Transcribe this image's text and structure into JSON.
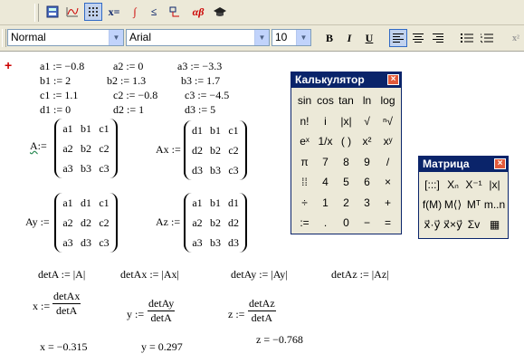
{
  "toolbar_math": {
    "icons": [
      "calculator-icon",
      "graph-icon",
      "matrix-icon",
      "evaluate-icon",
      "calculus-icon",
      "boolean-icon",
      "programming-icon",
      "greek-icon",
      "symbolic-icon"
    ],
    "eval_label": "x=",
    "greek_label": "αβ"
  },
  "format_bar": {
    "style": "Normal",
    "font": "Arial",
    "size": "10",
    "bold": "B",
    "italic": "I",
    "underline": "U"
  },
  "worksheet": {
    "cursor": "+",
    "defs": [
      [
        "a1 := −0.8",
        "a2 := 0",
        "a3 := −3.3"
      ],
      [
        "b1 := 2",
        "b2 := 1.3",
        "b3 := 1.7"
      ],
      [
        "c1 := 1.1",
        "c2 := −0.8",
        "c3 := −4.5"
      ],
      [
        "d1 := 0",
        "d2 := 1",
        "d3 := 5"
      ]
    ],
    "matrices": [
      {
        "name": "A",
        "op": ":=",
        "cells": [
          "a1",
          "b1",
          "c1",
          "a2",
          "b2",
          "c2",
          "a3",
          "b3",
          "c3"
        ]
      },
      {
        "name": "Ax",
        "op": ":=",
        "cells": [
          "d1",
          "b1",
          "c1",
          "d2",
          "b2",
          "c2",
          "d3",
          "b3",
          "c3"
        ]
      },
      {
        "name": "Ay",
        "op": ":=",
        "cells": [
          "a1",
          "d1",
          "c1",
          "a2",
          "d2",
          "c2",
          "a3",
          "d3",
          "c3"
        ]
      },
      {
        "name": "Az",
        "op": ":=",
        "cells": [
          "a1",
          "b1",
          "d1",
          "a2",
          "b2",
          "d2",
          "a3",
          "b3",
          "d3"
        ]
      }
    ],
    "dets": [
      "detA := |A|",
      "detAx := |Ax|",
      "detAy := |Ay|",
      "detAz := |Az|"
    ],
    "solutions": [
      {
        "lhs": "x :=",
        "num": "detAx",
        "den": "detA"
      },
      {
        "lhs": "y :=",
        "num": "detAy",
        "den": "detA"
      },
      {
        "lhs": "z :=",
        "num": "detAz",
        "den": "detA"
      }
    ],
    "results": [
      "x = −0.315",
      "y = 0.297",
      "z = −0.768"
    ]
  },
  "calculator": {
    "title": "Калькулятор",
    "close": "×",
    "keys": [
      "sin",
      "cos",
      "tan",
      "ln",
      "log",
      "n!",
      "i",
      "|x|",
      "√",
      "ⁿ√",
      "eˣ",
      "1/x",
      "( )",
      "x²",
      "xʸ",
      "π",
      "7",
      "8",
      "9",
      "/",
      "⁞⁞",
      "4",
      "5",
      "6",
      "×",
      "÷",
      "1",
      "2",
      "3",
      "+",
      ":=",
      ".",
      "0",
      "−",
      "="
    ]
  },
  "matrix_palette": {
    "title": "Матрица",
    "close": "×",
    "keys": [
      "[:::]",
      "Xₙ",
      "X⁻¹",
      "|x|",
      "f(M)",
      "M⟨⟩",
      "Mᵀ",
      "m..n",
      "x⃗·y⃗",
      "x⃗×y⃗",
      "Σv",
      "▦"
    ]
  }
}
